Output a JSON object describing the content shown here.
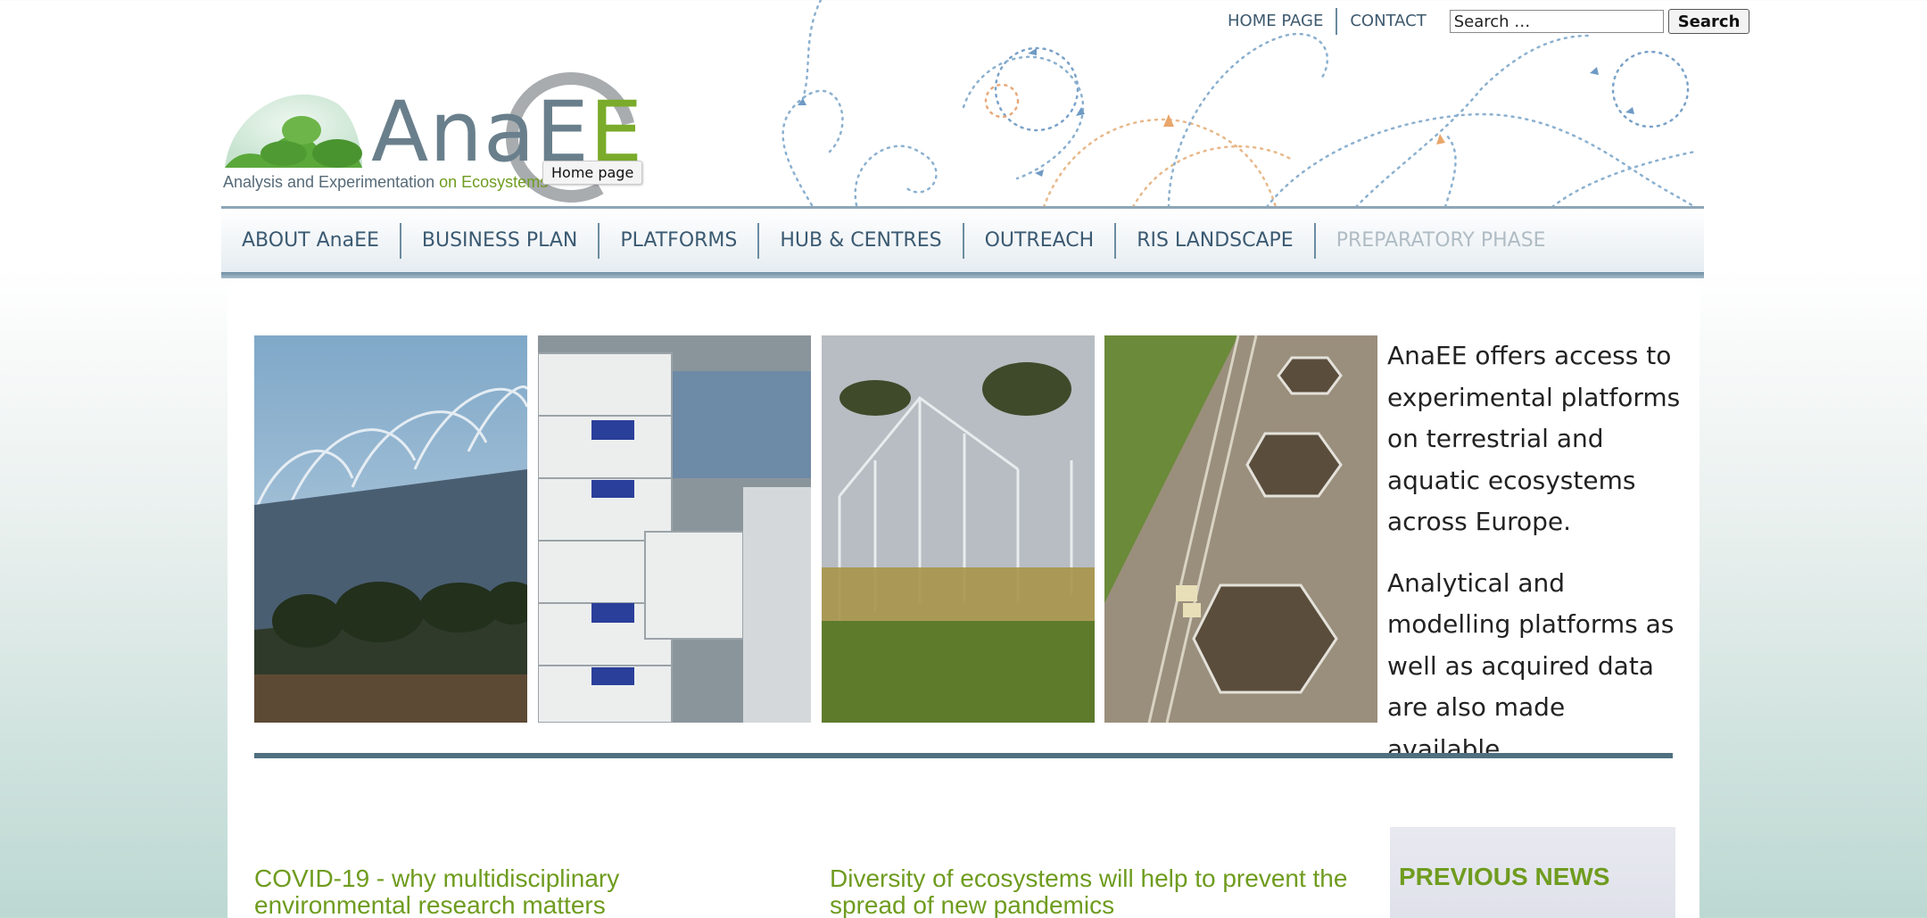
{
  "topbar": {
    "home": "HOME PAGE",
    "contact": "CONTACT",
    "search_placeholder": "Search …",
    "search_button": "Search"
  },
  "logo": {
    "name_gray": "AnaE",
    "name_green": "E",
    "tagline_gray": "Analysis and Experimentation ",
    "tagline_green": "on Ecosystems",
    "tooltip": "Home page"
  },
  "nav": {
    "items": [
      {
        "label": "ABOUT AnaEE"
      },
      {
        "label": "BUSINESS PLAN"
      },
      {
        "label": "PLATFORMS"
      },
      {
        "label": "HUB & CENTRES"
      },
      {
        "label": "OUTREACH"
      },
      {
        "label": "RIS LANDSCAPE"
      },
      {
        "label": "PREPARATORY PHASE"
      }
    ]
  },
  "intro": {
    "p1": "AnaEE offers access to experimental platforms on terrestrial and aquatic ecosystems across Europe.",
    "p2": "Analytical and modelling platforms as well as acquired data are also made available."
  },
  "news": {
    "items": [
      {
        "title": "COVID-19 - why multidisciplinary environmental research matters"
      },
      {
        "title": "Diversity of ecosystems will help to prevent the spread of new pandemics"
      }
    ],
    "previous_title": "PREVIOUS NEWS"
  },
  "photos": [
    {
      "icon": "greenhouse-domes-photo"
    },
    {
      "icon": "lab-instruments-photo"
    },
    {
      "icon": "field-greenhouse-photo"
    },
    {
      "icon": "aerial-plots-photo"
    }
  ],
  "colors": {
    "accent_green": "#6f9c1f",
    "nav_text": "#3b5a72",
    "divider": "#4f6f80"
  }
}
